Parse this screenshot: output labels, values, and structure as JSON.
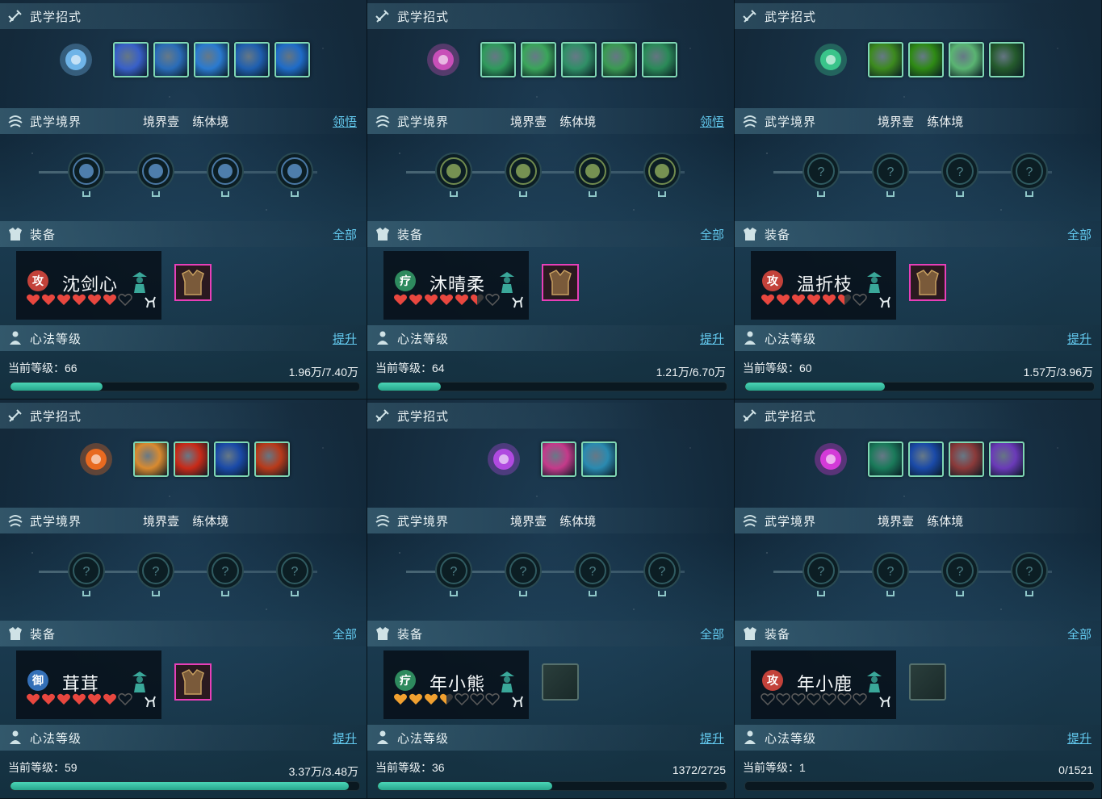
{
  "labels": {
    "skill_header": "武学招式",
    "realm_header": "武学境界",
    "realm_level": "境界壹",
    "realm_stage": "练体境",
    "realm_action": "领悟",
    "equip_header": "装备",
    "equip_action": "全部",
    "heart_header": "心法等级",
    "heart_action": "提升",
    "current_level_prefix": "当前等级："
  },
  "colors": {
    "accent_link": "#63c9ee",
    "progress_fill": "#3cc4a6",
    "heart_red": "#e8473f",
    "heart_orange": "#f0a030",
    "heart_empty": "#3a3a3a",
    "epic_border": "#e83fb8"
  },
  "panels": [
    {
      "main_skill_icon": "blue-orb-icon",
      "main_skill_color": "#6fb4e8",
      "skills": [
        "blue-sword-slash",
        "blue-water-wave",
        "blue-blade-strike",
        "blue-wind-cut",
        "blue-leaping-figure"
      ],
      "skill_colors": [
        "#3860c8",
        "#2a6cb8",
        "#2a7ad0",
        "#1f5fb0",
        "#1f6cc8"
      ],
      "realm_action_visible": true,
      "realm_nodes": [
        "feather-icon",
        "swirl-icon",
        "blade-icon",
        "sword-icon"
      ],
      "realm_node_color": "#5a8fc4",
      "character": {
        "role": "攻",
        "role_color": "#c3423a",
        "name": "沈剑心"
      },
      "hearts": {
        "filled": 6,
        "half": 0,
        "total": 7,
        "color": "red"
      },
      "gear": "epic",
      "level": "66",
      "exp": "1.96万/7.40万",
      "progress": 0.265
    },
    {
      "main_skill_icon": "purple-dancer-icon",
      "main_skill_color": "#c84fb8",
      "skills": [
        "green-dragon",
        "green-leaf-storm",
        "green-whirl",
        "green-crescent",
        "green-spirit"
      ],
      "skill_colors": [
        "#2f9a5c",
        "#3aa55a",
        "#2f8f66",
        "#3a9a52",
        "#2a8a58"
      ],
      "realm_action_visible": true,
      "realm_nodes": [
        "sprout-icon",
        "plus-icon",
        "spiral-icon",
        "crown-icon"
      ],
      "realm_node_color": "#8aa65a",
      "character": {
        "role": "疗",
        "role_color": "#2e8a5e",
        "name": "沐晴柔"
      },
      "hearts": {
        "filled": 5,
        "half": 1,
        "total": 7,
        "color": "red"
      },
      "gear": "epic",
      "level": "64",
      "exp": "1.21万/6.70万",
      "progress": 0.18
    },
    {
      "main_skill_icon": "green-wings-icon",
      "main_skill_color": "#3ac48a",
      "skills": [
        "green-claw",
        "green-spear",
        "green-ring",
        "green-yinyang"
      ],
      "skill_colors": [
        "#3c8a1e",
        "#2e8a14",
        "#5ab472",
        "#245a2c"
      ],
      "realm_action_visible": false,
      "realm_nodes": [
        "question-icon",
        "question-icon",
        "question-icon",
        "question-icon"
      ],
      "realm_node_color": "#3a6a70",
      "character": {
        "role": "攻",
        "role_color": "#c3423a",
        "name": "温折枝"
      },
      "hearts": {
        "filled": 5,
        "half": 1,
        "total": 7,
        "color": "red"
      },
      "gear": "epic",
      "level": "60",
      "exp": "1.57万/3.96万",
      "progress": 0.4
    },
    {
      "main_skill_icon": "fire-meditation-icon",
      "main_skill_color": "#e86a20",
      "skills": [
        "golden-buddha",
        "red-explosion",
        "blue-crescent",
        "red-vortex"
      ],
      "skill_colors": [
        "#d88a30",
        "#c82a18",
        "#1a4aa8",
        "#b83a1a"
      ],
      "realm_action_visible": false,
      "realm_nodes": [
        "question-icon",
        "question-icon",
        "question-icon",
        "question-icon"
      ],
      "realm_node_color": "#3a6a70",
      "character": {
        "role": "御",
        "role_color": "#3470b8",
        "name": "茸茸"
      },
      "hearts": {
        "filled": 6,
        "half": 0,
        "total": 7,
        "color": "red"
      },
      "gear": "epic",
      "level": "59",
      "exp": "3.37万/3.48万",
      "progress": 0.97
    },
    {
      "main_skill_icon": "purple-cone-icon",
      "main_skill_color": "#b04ae0",
      "skills": [
        "pink-orb-slash",
        "cyan-fan"
      ],
      "skill_colors": [
        "#c43a8a",
        "#2a8ab0"
      ],
      "realm_action_visible": false,
      "realm_nodes": [
        "question-icon",
        "question-icon",
        "question-icon",
        "question-icon"
      ],
      "realm_node_color": "#3a6a70",
      "character": {
        "role": "疗",
        "role_color": "#2e8a5e",
        "name": "年小熊"
      },
      "hearts": {
        "filled": 3,
        "half": 1,
        "total": 7,
        "color": "orange"
      },
      "gear": "empty",
      "level": "36",
      "exp": "1372/2725",
      "progress": 0.5
    },
    {
      "main_skill_icon": "magenta-sigil-icon",
      "main_skill_color": "#d43ad8",
      "skills": [
        "green-scorpion",
        "blue-coil",
        "red-scales",
        "purple-cast"
      ],
      "skill_colors": [
        "#1a7a5a",
        "#1a4aa8",
        "#8a3a3a",
        "#6a3ab8"
      ],
      "realm_action_visible": false,
      "realm_nodes": [
        "question-icon",
        "question-icon",
        "question-icon",
        "question-icon"
      ],
      "realm_node_color": "#3a6a70",
      "character": {
        "role": "攻",
        "role_color": "#c3423a",
        "name": "年小鹿"
      },
      "hearts": {
        "filled": 0,
        "half": 0,
        "total": 7,
        "color": "red"
      },
      "gear": "empty",
      "level": "1",
      "exp": "0/1521",
      "progress": 0.0
    }
  ]
}
